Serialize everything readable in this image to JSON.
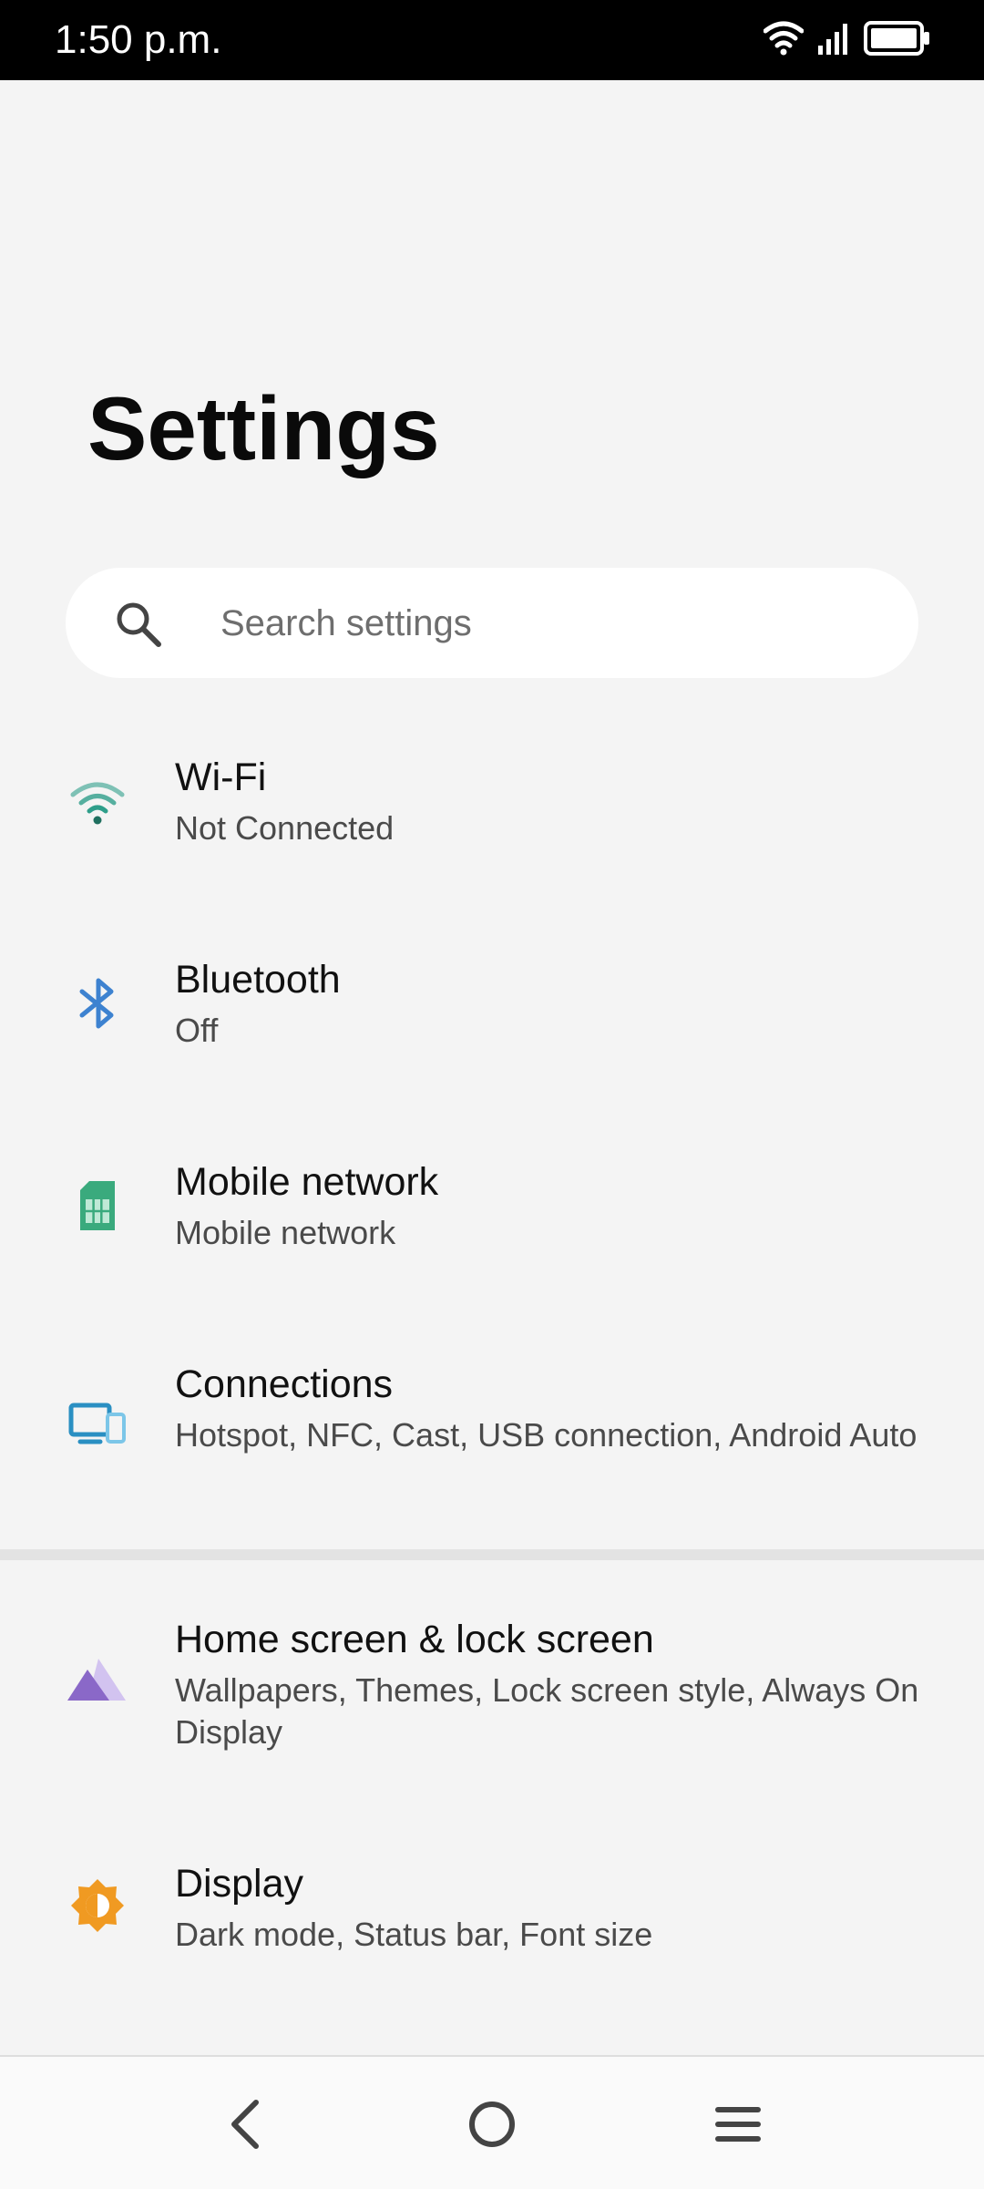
{
  "status_bar": {
    "time": "1:50 p.m."
  },
  "header": {
    "title": "Settings"
  },
  "search": {
    "placeholder": "Search settings"
  },
  "items": [
    {
      "title": "Wi-Fi",
      "subtitle": "Not Connected",
      "icon": "wifi-icon",
      "color": "#2e9e8a"
    },
    {
      "title": "Bluetooth",
      "subtitle": "Off",
      "icon": "bluetooth-icon",
      "color": "#3d82d0"
    },
    {
      "title": "Mobile network",
      "subtitle": "Mobile network",
      "icon": "sim-card-icon",
      "color": "#3aaa7d"
    },
    {
      "title": "Connections",
      "subtitle": "Hotspot, NFC, Cast, USB connection, Android Auto",
      "icon": "devices-icon",
      "color": "#2a8fc2"
    },
    {
      "title": "Home screen & lock screen",
      "subtitle": "Wallpapers, Themes, Lock screen style, Always On Display",
      "icon": "wallpaper-icon",
      "color": "#8a68c8"
    },
    {
      "title": "Display",
      "subtitle": "Dark mode, Status bar, Font size",
      "icon": "brightness-icon",
      "color": "#f09a22"
    }
  ]
}
